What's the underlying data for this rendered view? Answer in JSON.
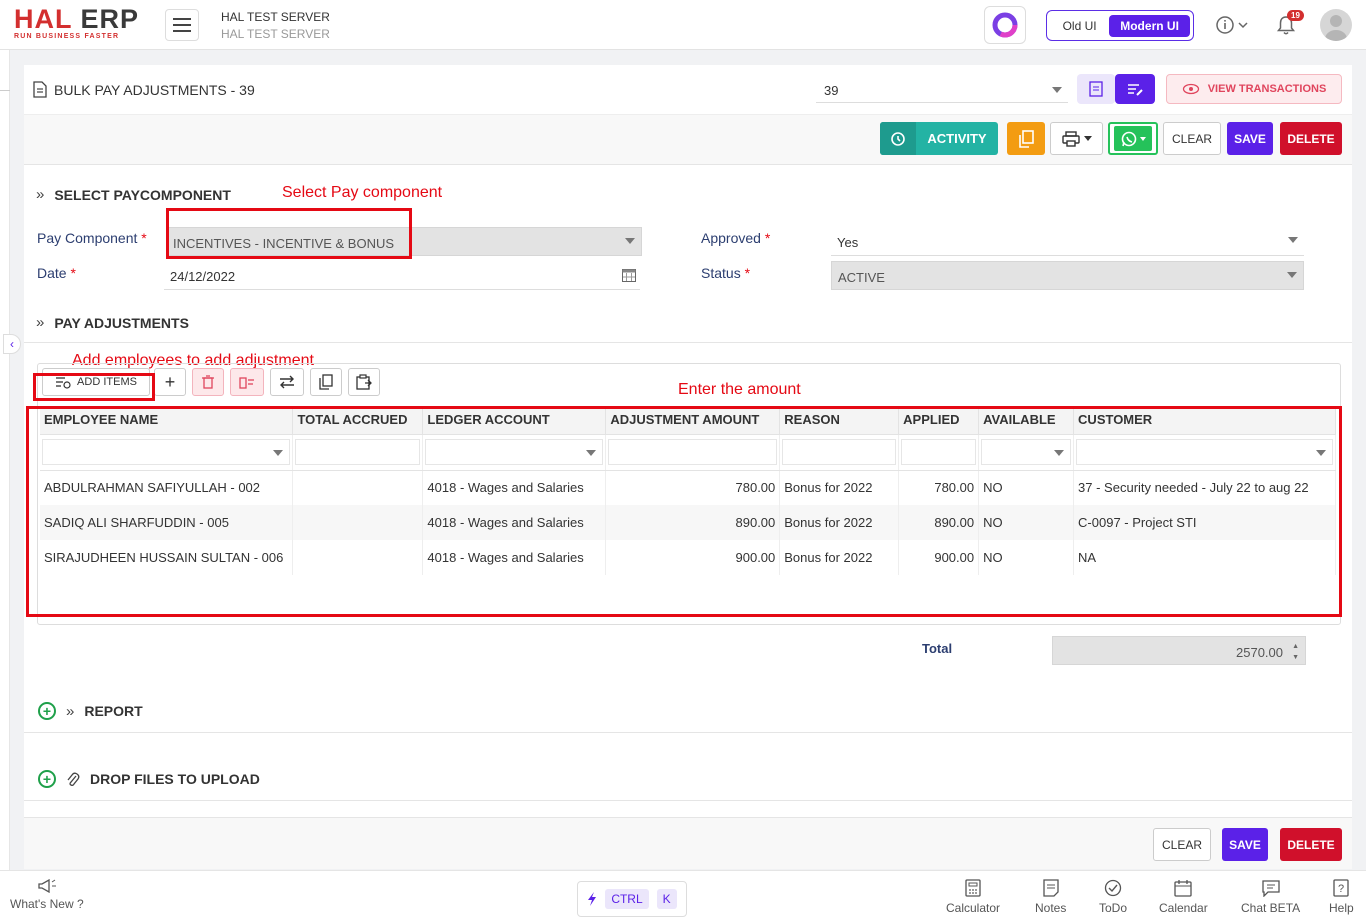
{
  "brand": {
    "logo_main": "HAL",
    "logo_accent": "ERP",
    "tagline": "RUN BUSINESS FASTER"
  },
  "server": {
    "name": "HAL TEST SERVER",
    "subtitle": "HAL TEST SERVER"
  },
  "ui_toggle": {
    "old": "Old UI",
    "modern": "Modern UI"
  },
  "notifications": {
    "count": "19"
  },
  "document": {
    "title": "BULK PAY ADJUSTMENTS - 39",
    "selector_value": "39",
    "view_transactions": "VIEW TRANSACTIONS"
  },
  "toolbar": {
    "activity": "ACTIVITY",
    "clear": "CLEAR",
    "save": "SAVE",
    "delete": "DELETE"
  },
  "sections": {
    "select_pay": "SELECT PAYCOMPONENT",
    "pay_adjustments": "PAY ADJUSTMENTS",
    "report": "REPORT",
    "drop_files": "DROP FILES TO UPLOAD"
  },
  "annotations": {
    "select_pay": "Select Pay component",
    "add_employees": "Add employees to add adjustment",
    "enter_amount": "Enter the amount"
  },
  "form": {
    "pay_component_label": "Pay Component",
    "pay_component_value": "INCENTIVES - INCENTIVE & BONUS",
    "date_label": "Date",
    "date_value": "24/12/2022",
    "approved_label": "Approved",
    "approved_value": "Yes",
    "status_label": "Status",
    "status_value": "ACTIVE"
  },
  "grid": {
    "add_items": "ADD ITEMS",
    "columns": [
      "EMPLOYEE NAME",
      "TOTAL ACCRUED",
      "LEDGER ACCOUNT",
      "ADJUSTMENT AMOUNT",
      "REASON",
      "APPLIED",
      "AVAILABLE",
      "CUSTOMER"
    ],
    "rows": [
      [
        "ABDULRAHMAN SAFIYULLAH - 002",
        "",
        "4018 - Wages and Salaries",
        "780.00",
        "Bonus for 2022",
        "780.00",
        "NO",
        "37 - Security needed - July 22 to aug 22"
      ],
      [
        "SADIQ ALI SHARFUDDIN - 005",
        "",
        "4018 - Wages and Salaries",
        "890.00",
        "Bonus for 2022",
        "890.00",
        "NO",
        "C-0097 - Project STI"
      ],
      [
        "SIRAJUDHEEN HUSSAIN SULTAN - 006",
        "",
        "4018 - Wages and Salaries",
        "900.00",
        "Bonus for 2022",
        "900.00",
        "NO",
        "NA"
      ]
    ]
  },
  "total": {
    "label": "Total",
    "value": "2570.00"
  },
  "footer": {
    "whats_new": "What's New ?",
    "ctrl": "CTRL",
    "k": "K",
    "items": [
      "Calculator",
      "Notes",
      "ToDo",
      "Calendar",
      "Chat BETA",
      "Help"
    ]
  },
  "colors": {
    "accent": "#5b21e8",
    "delete": "#d0102b",
    "annotation": "#e50914",
    "activity": "#23b3a4"
  }
}
